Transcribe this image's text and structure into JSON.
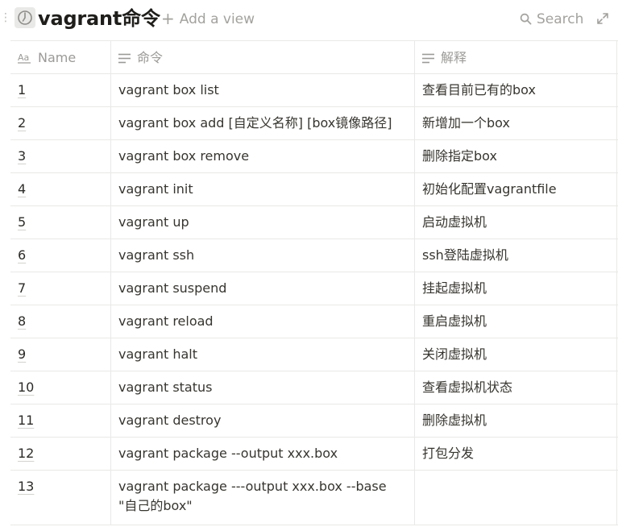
{
  "page": {
    "title": "vagrant命令",
    "add_view_label": "Add a view",
    "search_label": "Search"
  },
  "table": {
    "columns": [
      {
        "label": "Name",
        "icon": "title-type-icon"
      },
      {
        "label": "命令",
        "icon": "text-type-icon"
      },
      {
        "label": "解释",
        "icon": "text-type-icon"
      }
    ],
    "rows": [
      {
        "name": "1",
        "cmd": "vagrant box list",
        "desc": "查看目前已有的box"
      },
      {
        "name": "2",
        "cmd": "vagrant box add [自定义名称] [box镜像路径]",
        "desc": "新增加一个box"
      },
      {
        "name": "3",
        "cmd": "vagrant box remove",
        "desc": "删除指定box"
      },
      {
        "name": "4",
        "cmd": "vagrant init",
        "desc": "初始化配置vagrantfile"
      },
      {
        "name": "5",
        "cmd": "vagrant up",
        "desc": "启动虚拟机"
      },
      {
        "name": "6",
        "cmd": "vagrant ssh",
        "desc": "ssh登陆虚拟机"
      },
      {
        "name": "7",
        "cmd": "vagrant suspend",
        "desc": "挂起虚拟机"
      },
      {
        "name": "8",
        "cmd": "vagrant reload",
        "desc": "重启虚拟机"
      },
      {
        "name": "9",
        "cmd": "vagrant halt",
        "desc": "关闭虚拟机"
      },
      {
        "name": "10",
        "cmd": "vagrant status",
        "desc": "查看虚拟机状态"
      },
      {
        "name": "11",
        "cmd": "vagrant destroy",
        "desc": "删除虚拟机"
      },
      {
        "name": "12",
        "cmd": "vagrant package --output xxx.box",
        "desc": "打包分发"
      },
      {
        "name": "13",
        "cmd": "vagrant package ---output xxx.box --base \"自己的box\"",
        "desc": ""
      }
    ]
  },
  "colors": {
    "text": "#37352f",
    "muted": "#9b9a97",
    "border": "#e9e9e7",
    "icon_bg": "#e9e9e7"
  }
}
